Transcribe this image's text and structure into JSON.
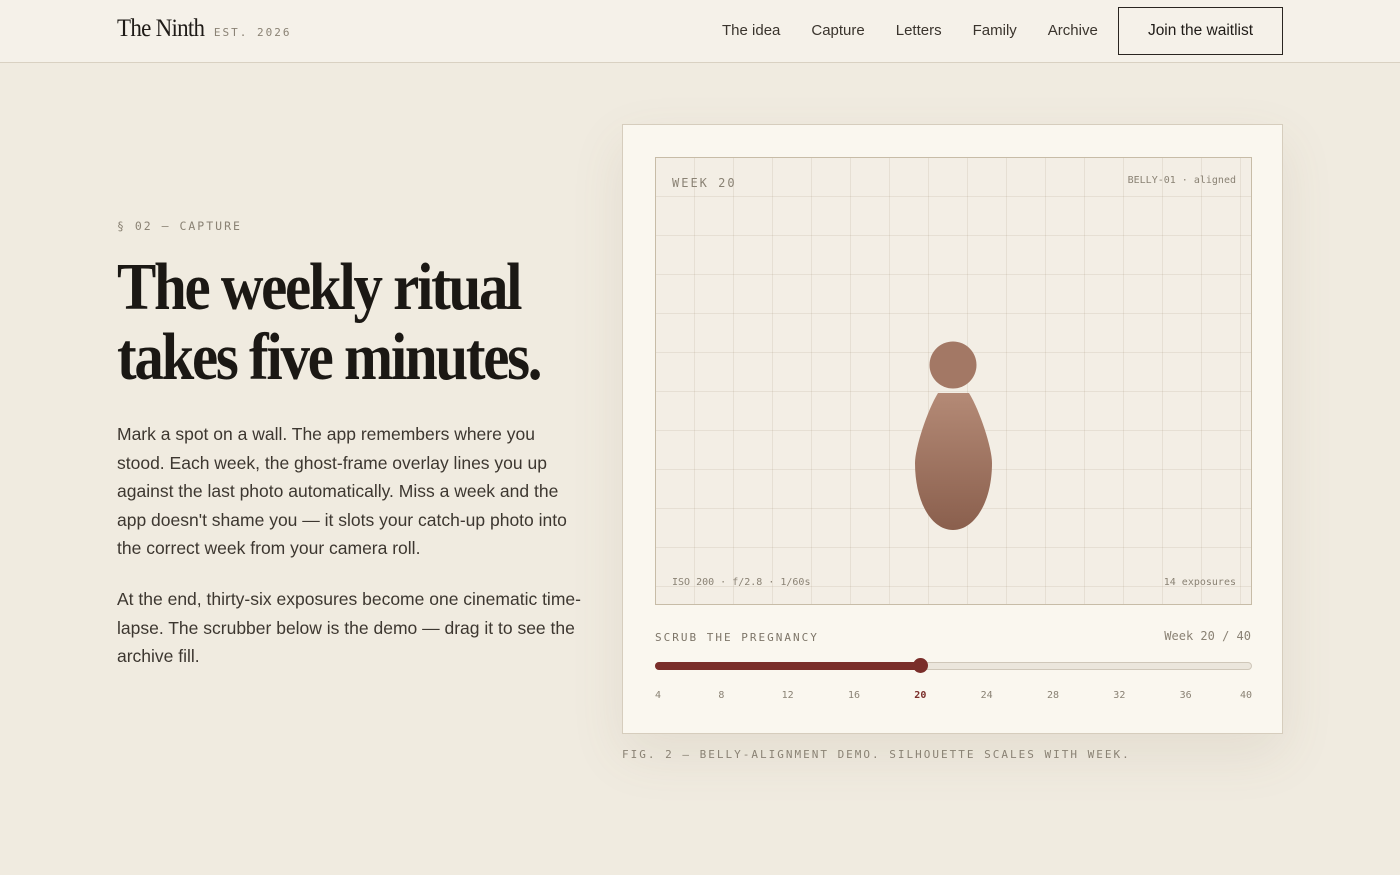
{
  "header": {
    "brand": "The Ninth",
    "est": "EST. 2026",
    "nav": [
      "The idea",
      "Capture",
      "Letters",
      "Family",
      "Archive"
    ],
    "cta_label": "Join the waitlist"
  },
  "hero": {
    "eyebrow": "§ 02 — CAPTURE",
    "headline_line1": "The weekly ritual",
    "headline_line2": "takes five minutes.",
    "paragraph1": "Mark a spot on a wall. The app remembers where you stood. Each week, the ghost-frame overlay lines you up against the last photo automatically. Miss a week and the app doesn't shame you — it slots your catch-up photo into the correct week from your camera roll.",
    "paragraph2": "At the end, thirty-six exposures become one cinematic time-lapse. The scrubber below is the demo — drag it to see the archive fill."
  },
  "demo": {
    "viewfinder_week": "WEEK 20",
    "alignment_status": "BELLY-01 · aligned",
    "camera_settings": "ISO 200 · f/2.8 · 1/60s",
    "exposure_count": "14 exposures",
    "scrub_label": "SCRUB THE PREGNANCY",
    "scrub_readout": "Week 20 / 40",
    "current_week": 20,
    "min_week": 4,
    "max_week": 40,
    "tick_labels": [
      "4",
      "8",
      "12",
      "16",
      "20",
      "24",
      "28",
      "32",
      "36",
      "40"
    ],
    "caption": "FIG. 2 — BELLY-ALIGNMENT DEMO. SILHOUETTE SCALES WITH WEEK.",
    "colors": {
      "accent": "#7a2e2a",
      "silhouette_top": "#b48a76",
      "silhouette_bottom": "#8a5f4d"
    }
  }
}
